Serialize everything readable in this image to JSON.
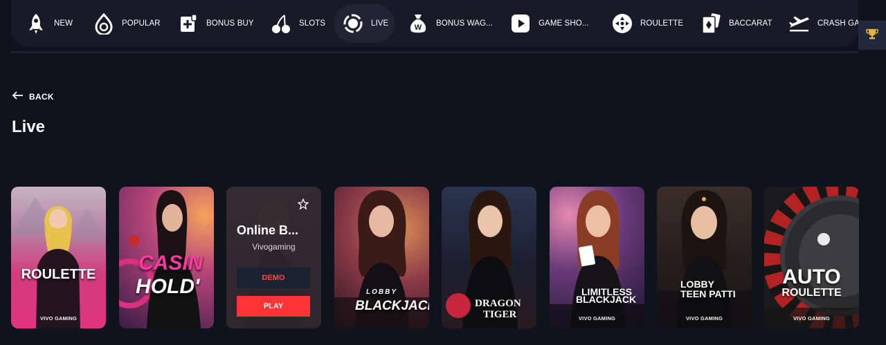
{
  "nav": {
    "items": [
      {
        "label": "NEW",
        "icon": "rocket-icon"
      },
      {
        "label": "POPULAR",
        "icon": "drop-icon"
      },
      {
        "label": "BONUS BUY",
        "icon": "bonus-buy-icon"
      },
      {
        "label": "SLOTS",
        "icon": "cherry-icon"
      },
      {
        "label": "LIVE",
        "icon": "live-icon"
      },
      {
        "label": "BONUS WAG...",
        "icon": "money-bag-icon"
      },
      {
        "label": "GAME SHO...",
        "icon": "play-icon"
      },
      {
        "label": "ROULETTE",
        "icon": "roulette-icon"
      },
      {
        "label": "BACCARAT",
        "icon": "cards-icon"
      },
      {
        "label": "CRASH GA",
        "icon": "plane-icon"
      }
    ],
    "active": "LIVE",
    "trophy_icon": "trophy-icon"
  },
  "header": {
    "back_label": "BACK",
    "title": "Live"
  },
  "games": [
    {
      "title": "ROULETTE",
      "provider": "VIVO GAMING"
    },
    {
      "title_line1": "CASIN",
      "title_line2": "HOLD'",
      "provider": ""
    },
    {
      "title": "Online B...",
      "provider": "Vivogaming",
      "demo_label": "DEMO",
      "play_label": "PLAY",
      "hover": true
    },
    {
      "title_small": "LOBBY",
      "title": "BLACKJACK",
      "provider": ""
    },
    {
      "title_line1": "DRAGON",
      "title_line2": "TIGER",
      "provider": ""
    },
    {
      "title_line1": "LIMITLESS",
      "title_line2": "BLACKJACK",
      "provider": "VIVO GAMING"
    },
    {
      "title_line1": "LOBBY",
      "title_line2": "TEEN PATTI",
      "provider": "VIVO GAMING"
    },
    {
      "title_line1": "AUTO",
      "title_line2": "ROULETTE",
      "provider": "VIVO GAMING"
    }
  ],
  "colors": {
    "background": "#0f131d",
    "nav": "#161b27",
    "accent": "#ff3535",
    "gold": "#e8b23a"
  }
}
